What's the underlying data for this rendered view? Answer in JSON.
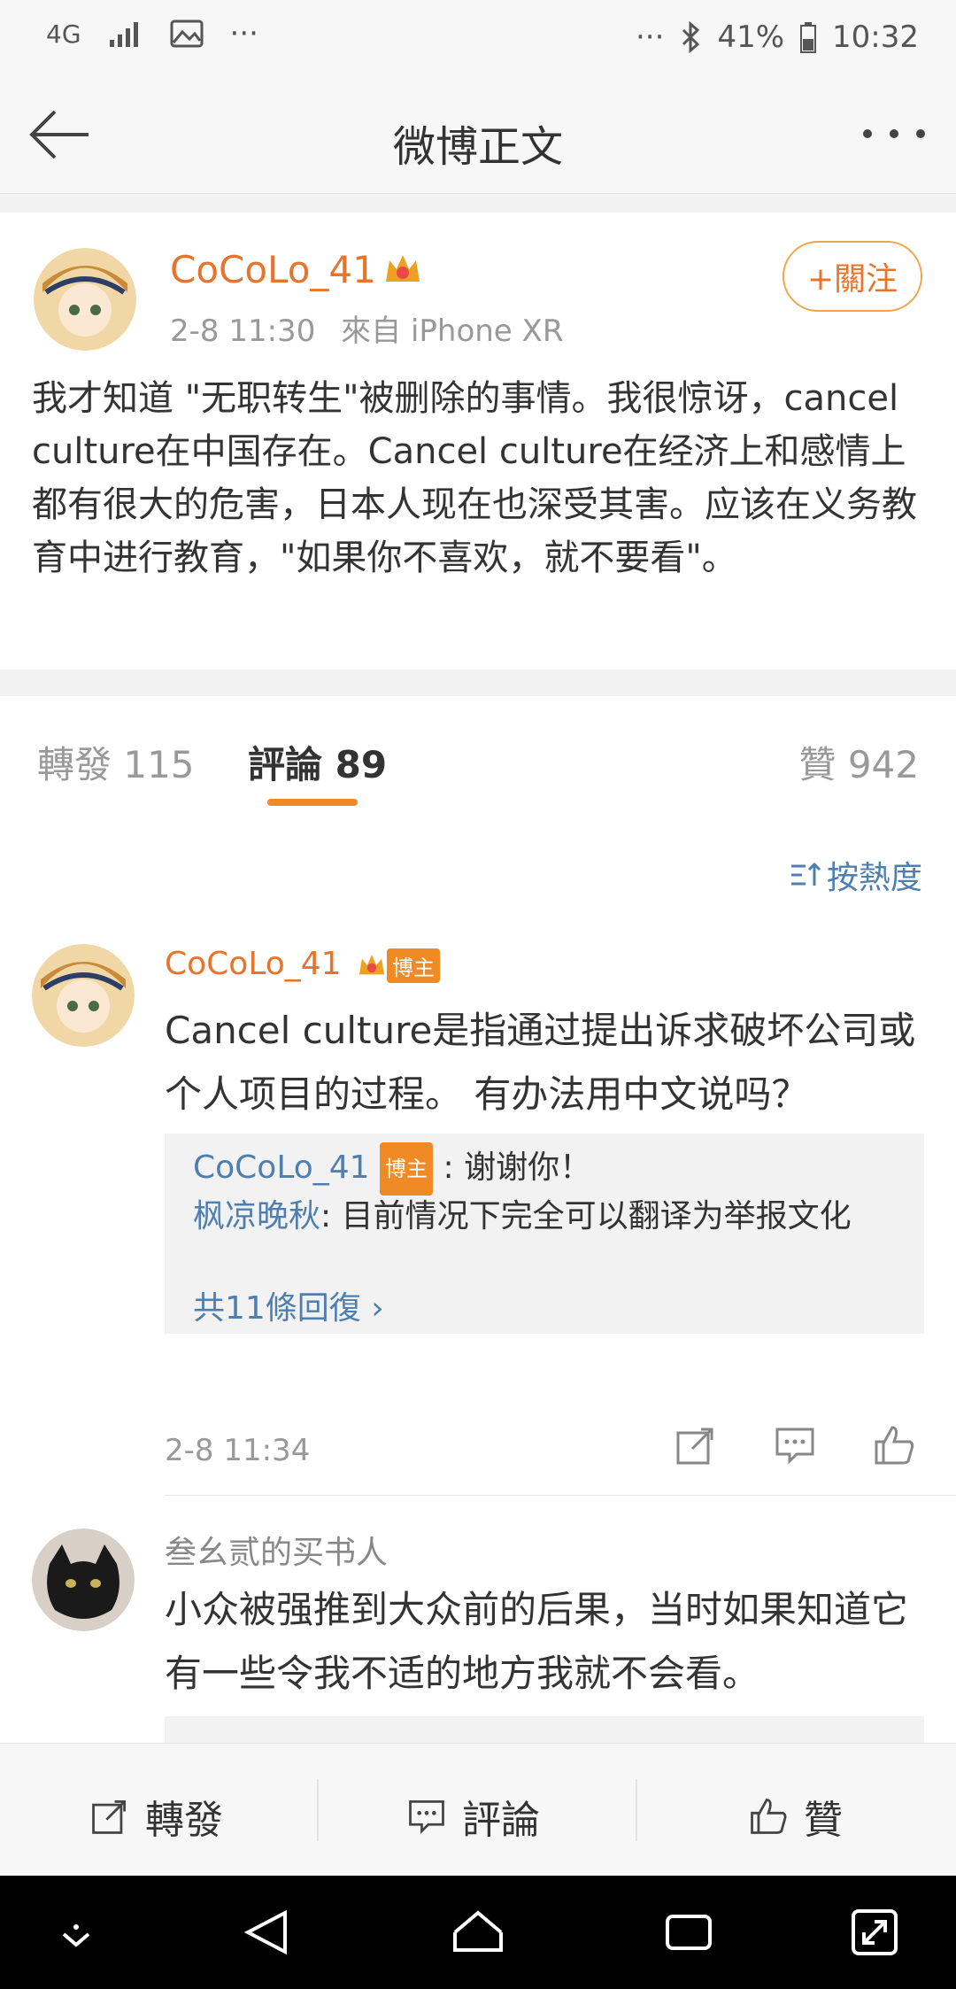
{
  "status_bar": {
    "network": "4G",
    "battery": "41%",
    "time": "10:32",
    "dots": "···"
  },
  "header": {
    "title": "微博正文"
  },
  "post": {
    "username": "CoCoLo_41",
    "timestamp": "2-8 11:30",
    "source": "來自 iPhone XR",
    "follow_label": "+關注",
    "text": "我才知道 \"无职转生\"被删除的事情。我很惊讶，cancel culture在中国存在。Cancel culture在经济上和感情上都有很大的危害，日本人现在也深受其害。应该在义务教育中进行教育，\"如果你不喜欢，就不要看\"。"
  },
  "tabs": {
    "repost": "轉發 115",
    "comment": "評論 89",
    "like": "贊 942"
  },
  "sort_label": "按熱度",
  "comments": [
    {
      "name": "CoCoLo_41",
      "badge": "博主",
      "text": "Cancel culture是指通过提出诉求破坏公司或个人项目的过程。 有办法用中文说吗？",
      "replies": [
        {
          "name": "CoCoLo_41",
          "badge": "博主",
          "text": ": 谢谢你！"
        },
        {
          "name": "枫凉晚秋",
          "text": ": 目前情况下完全可以翻译为举报文化"
        }
      ],
      "more_replies": "共11條回復",
      "time": "2-8 11:34"
    },
    {
      "name": "叁幺贰的买书人",
      "text": "小众被强推到大众前的后果，当时如果知道它有一些令我不适的地方我就不会看。"
    }
  ],
  "bottom_bar": {
    "repost": "轉發",
    "comment": "評論",
    "like": "贊"
  },
  "colors": {
    "accent": "#e8742a",
    "link": "#4e7fae",
    "tab_underline": "#f08a24"
  }
}
